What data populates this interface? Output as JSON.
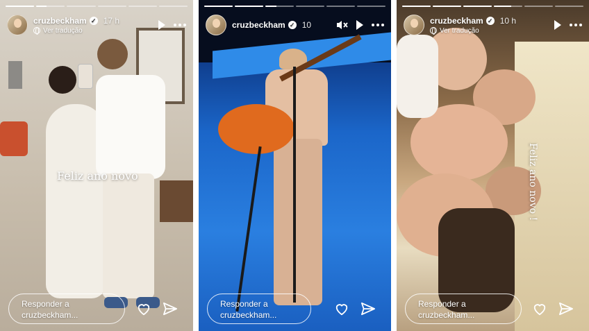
{
  "stories": [
    {
      "username": "cruzbeckham",
      "time": "17 h",
      "translate_label": "Ver tradução",
      "overlay_text": "Feliz ano novo",
      "reply_line1": "Responder a",
      "reply_line2": "cruzbeckham...",
      "progress": [
        1,
        0.35,
        0,
        0,
        0,
        0
      ]
    },
    {
      "username": "cruzbeckham",
      "time": "10",
      "reply_line1": "Responder a",
      "reply_line2": "cruzbeckham...",
      "progress": [
        1,
        1,
        0.4,
        0,
        0,
        0
      ]
    },
    {
      "username": "cruzbeckham",
      "time": "10 h",
      "translate_label": "Ver tradução",
      "overlay_text": "Feliz ano novo !",
      "reply_line1": "Responder a",
      "reply_line2": "cruzbeckham...",
      "progress": [
        1,
        1,
        1,
        0.6,
        0,
        0
      ]
    }
  ],
  "icons": {
    "verified": "verified-badge-icon",
    "play": "play-icon",
    "mute": "muted-speaker-icon",
    "more": "more-options-icon",
    "like": "heart-icon",
    "share": "send-icon",
    "translate": "globe-icon"
  },
  "colors": {
    "white": "#ffffff",
    "stage_blue": "#1b66c9",
    "guitar_orange": "#e06a1e"
  }
}
